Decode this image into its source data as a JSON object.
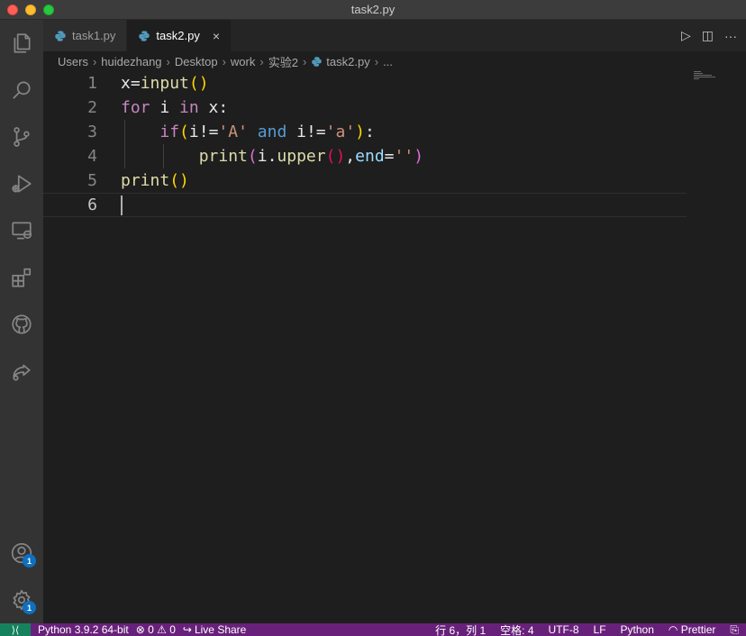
{
  "window": {
    "title": "task2.py"
  },
  "tabs": [
    {
      "label": "task1.py",
      "active": false
    },
    {
      "label": "task2.py",
      "active": true,
      "close": "×"
    }
  ],
  "tab_actions": {
    "run": "▷",
    "split": "◫",
    "more": "···"
  },
  "breadcrumb": {
    "items": [
      "Users",
      "huidezhang",
      "Desktop",
      "work",
      "实验2",
      "task2.py",
      "..."
    ],
    "separator": "›"
  },
  "editor": {
    "line_numbers": [
      "1",
      "2",
      "3",
      "4",
      "5",
      "6"
    ],
    "current_line": 6,
    "code_lines": [
      "x=input()",
      "for i in x:",
      "    if(i!='A' and i!='a'):",
      "        print(i.upper(),end='')",
      "print()",
      ""
    ]
  },
  "activity": {
    "icons": [
      "files-icon",
      "search-icon",
      "source-control-icon",
      "run-debug-icon",
      "remote-explorer-icon",
      "extensions-icon",
      "github-icon",
      "live-share-icon"
    ],
    "account_badge": "1",
    "settings_badge": "1"
  },
  "status": {
    "remote": "⟩⟨",
    "python_env": "Python 3.9.2 64-bit",
    "errors": "⊗ 0",
    "warnings": "⚠ 0",
    "live_share": "Live Share",
    "position": "行 6，列 1",
    "spaces": "空格: 4",
    "encoding": "UTF-8",
    "eol": "LF",
    "language": "Python",
    "prettier": "Prettier"
  },
  "colors": {
    "statusbar": "#68217a",
    "remote": "#16825d",
    "activitybar": "#333333",
    "editor": "#1e1e1e"
  }
}
